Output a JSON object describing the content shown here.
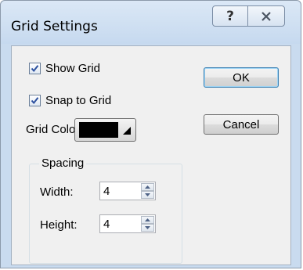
{
  "window": {
    "title": "Grid Settings"
  },
  "checks": {
    "show_grid": {
      "label": "Show Grid",
      "checked": true
    },
    "snap_to_grid": {
      "label": "Snap to Grid",
      "checked": true
    }
  },
  "grid_color": {
    "label": "Grid Color:",
    "value": "#000000"
  },
  "spacing": {
    "legend": "Spacing",
    "width": {
      "label": "Width:",
      "value": "4"
    },
    "height": {
      "label": "Height:",
      "value": "4"
    }
  },
  "buttons": {
    "ok": "OK",
    "cancel": "Cancel"
  },
  "colors": {
    "titlebar": "#c9dbef",
    "client": "#f0f0f0",
    "default_button_border": "#3c7fb1"
  },
  "icons": {
    "help": "question-mark-icon",
    "close": "close-x-icon",
    "check": "checkmark-icon"
  }
}
